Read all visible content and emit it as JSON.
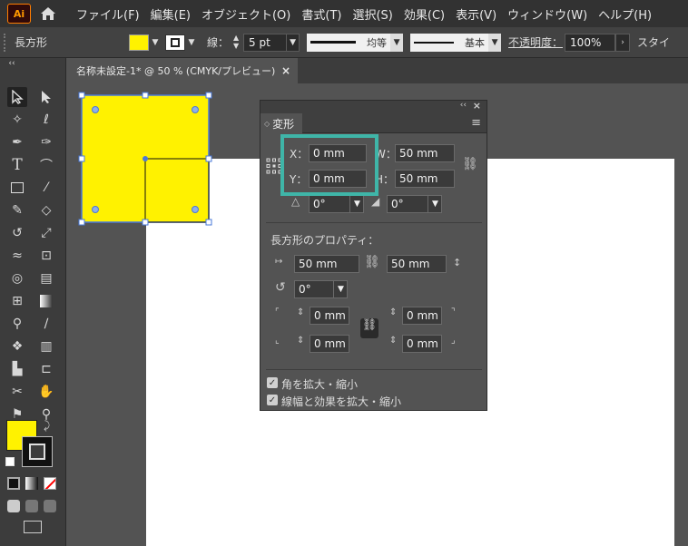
{
  "menu": {
    "logo": "Ai",
    "items": [
      "ファイル(F)",
      "編集(E)",
      "オブジェクト(O)",
      "書式(T)",
      "選択(S)",
      "効果(C)",
      "表示(V)",
      "ウィンドウ(W)",
      "ヘルプ(H)"
    ]
  },
  "control": {
    "object_label": "長方形",
    "fill_color": "#fff200",
    "stroke_label": "線：",
    "stroke_weight": "5 pt",
    "profile_label": "均等",
    "brush_label": "基本",
    "opacity_label": "不透明度：",
    "opacity_value": "100%",
    "style_label": "スタイ"
  },
  "document": {
    "tab_title": "名称未設定-1* @ 50 % (CMYK/プレビュー)",
    "close": "×"
  },
  "panel": {
    "title": "変形",
    "x_label": "X：",
    "x_value": "0 mm",
    "y_label": "Y：",
    "y_value": "0 mm",
    "w_label": "W：",
    "w_value": "50 mm",
    "h_label": "H：",
    "h_value": "50 mm",
    "rotate_value": "0°",
    "shear_value": "0°",
    "rect_props_label": "長方形のプロパティ：",
    "rect_w": "50 mm",
    "rect_h": "50 mm",
    "rect_rotate": "0°",
    "corner_tl": "0 mm",
    "corner_tr": "0 mm",
    "corner_bl": "0 mm",
    "corner_br": "0 mm",
    "scale_corners": "角を拡大・縮小",
    "scale_strokes": "線幅と効果を拡大・縮小"
  },
  "colors": {
    "accent_highlight": "#3fb5a8",
    "shape_fill": "#fff200",
    "selection": "#4a78d8"
  }
}
